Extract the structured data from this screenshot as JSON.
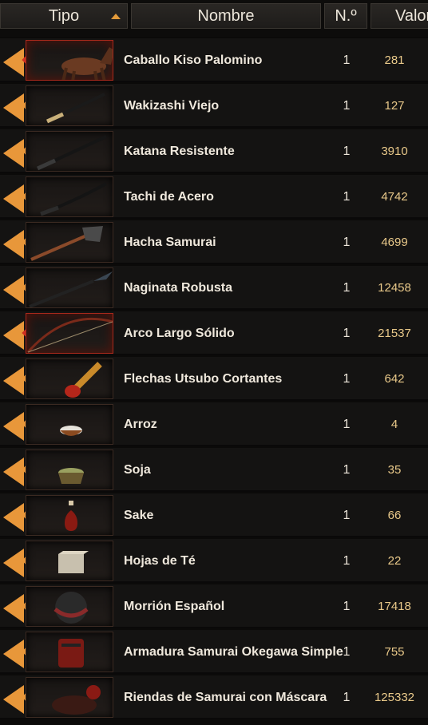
{
  "header": {
    "tipo": "Tipo",
    "nombre": "Nombre",
    "num": "N.º",
    "valor": "Valor"
  },
  "items": [
    {
      "name": "Caballo Kiso Palomino",
      "qty": "1",
      "value": "281",
      "icon": "horse-icon"
    },
    {
      "name": "Wakizashi Viejo",
      "qty": "1",
      "value": "127",
      "icon": "wakizashi-icon"
    },
    {
      "name": "Katana Resistente",
      "qty": "1",
      "value": "3910",
      "icon": "katana-icon"
    },
    {
      "name": "Tachi de Acero",
      "qty": "1",
      "value": "4742",
      "icon": "tachi-icon"
    },
    {
      "name": "Hacha Samurai",
      "qty": "1",
      "value": "4699",
      "icon": "axe-icon"
    },
    {
      "name": "Naginata Robusta",
      "qty": "1",
      "value": "12458",
      "icon": "naginata-icon"
    },
    {
      "name": "Arco Largo Sólido",
      "qty": "1",
      "value": "21537",
      "icon": "bow-icon"
    },
    {
      "name": "Flechas Utsubo Cortantes",
      "qty": "1",
      "value": "642",
      "icon": "quiver-icon"
    },
    {
      "name": "Arroz",
      "qty": "1",
      "value": "4",
      "icon": "rice-icon"
    },
    {
      "name": "Soja",
      "qty": "1",
      "value": "35",
      "icon": "soy-icon"
    },
    {
      "name": "Sake",
      "qty": "1",
      "value": "66",
      "icon": "sake-icon"
    },
    {
      "name": "Hojas de Té",
      "qty": "1",
      "value": "22",
      "icon": "tea-leaves-icon"
    },
    {
      "name": "Morrión Español",
      "qty": "1",
      "value": "17418",
      "icon": "helmet-icon"
    },
    {
      "name": "Armadura Samurai Okegawa Simple",
      "qty": "1",
      "value": "755",
      "icon": "armor-icon"
    },
    {
      "name": "Riendas de Samurai con Máscara",
      "qty": "1",
      "value": "125332",
      "icon": "reins-icon"
    }
  ]
}
